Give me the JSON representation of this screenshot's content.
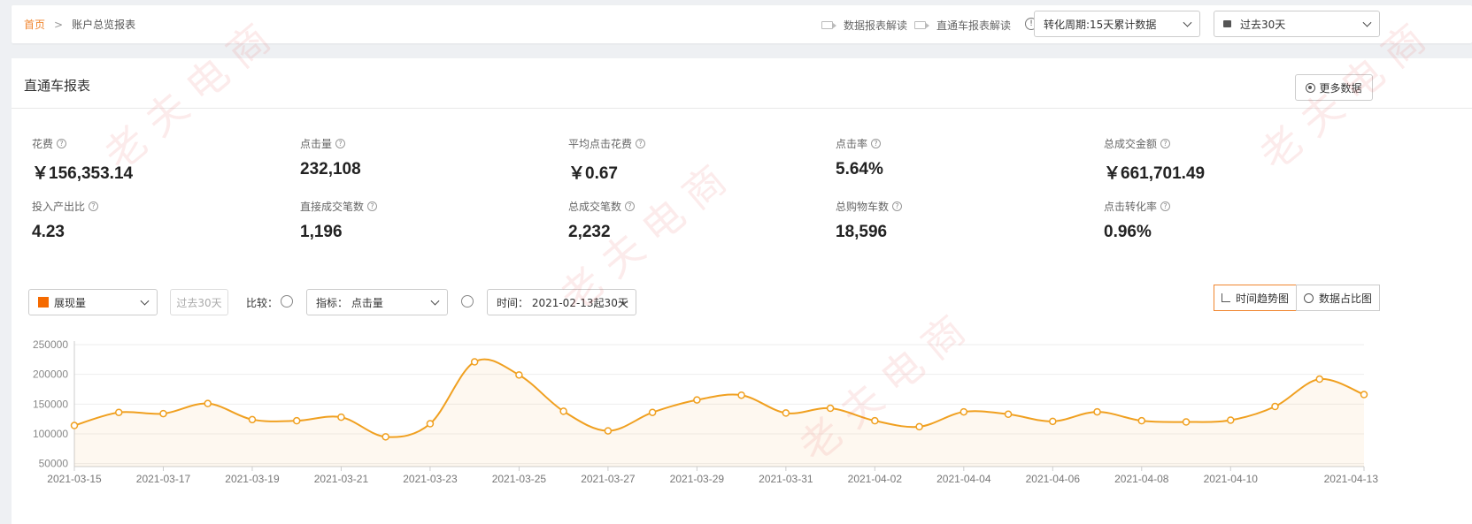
{
  "breadcrumb": {
    "home": "首页",
    "separator": ">",
    "current": "账户总览报表"
  },
  "topbar": {
    "link1": "数据报表解读",
    "link2": "直通车报表解读",
    "period_select": "转化周期:15天累计数据",
    "date_select": "过去30天"
  },
  "panel": {
    "title": "直通车报表",
    "more_button": "更多数据"
  },
  "metrics": [
    {
      "label": "花费",
      "value": "￥156,353.14"
    },
    {
      "label": "点击量",
      "value": "232,108"
    },
    {
      "label": "平均点击花费",
      "value": "￥0.67"
    },
    {
      "label": "点击率",
      "value": "5.64%"
    },
    {
      "label": "总成交金额",
      "value": "￥661,701.49"
    },
    {
      "label": "投入产出比",
      "value": "4.23"
    },
    {
      "label": "直接成交笔数",
      "value": "1,196"
    },
    {
      "label": "总成交笔数",
      "value": "2,232"
    },
    {
      "label": "总购物车数",
      "value": "18,596"
    },
    {
      "label": "点击转化率",
      "value": "0.96%"
    }
  ],
  "controls": {
    "metric_select": "展现量",
    "past_30": "过去30天",
    "compare_label": "比较：",
    "indicator_select": "指标： 点击量",
    "time_select": "时间： 2021-02-13起30天",
    "trend_button": "时间趋势图",
    "share_button": "数据占比图"
  },
  "colors": {
    "accent": "#f0862f",
    "line": "#f0a020",
    "swatch": "#f56a00"
  },
  "watermark": "老夫电商",
  "chart_data": {
    "type": "line",
    "x": [
      "2021-03-15",
      "2021-03-16",
      "2021-03-17",
      "2021-03-18",
      "2021-03-19",
      "2021-03-20",
      "2021-03-21",
      "2021-03-22",
      "2021-03-23",
      "2021-03-24",
      "2021-03-25",
      "2021-03-26",
      "2021-03-27",
      "2021-03-28",
      "2021-03-29",
      "2021-03-30",
      "2021-03-31",
      "2021-04-01",
      "2021-04-02",
      "2021-04-03",
      "2021-04-04",
      "2021-04-05",
      "2021-04-06",
      "2021-04-07",
      "2021-04-08",
      "2021-04-09",
      "2021-04-10",
      "2021-04-11",
      "2021-04-12",
      "2021-04-13"
    ],
    "x_tick_labels": [
      "2021-03-15",
      "2021-03-17",
      "2021-03-19",
      "2021-03-21",
      "2021-03-23",
      "2021-03-25",
      "2021-03-27",
      "2021-03-29",
      "2021-03-31",
      "2021-04-02",
      "2021-04-04",
      "2021-04-06",
      "2021-04-08",
      "2021-04-10",
      "2021-04-13"
    ],
    "values": [
      114000,
      136000,
      134000,
      151000,
      124000,
      122000,
      128000,
      95000,
      117000,
      221000,
      199000,
      138000,
      105000,
      136000,
      157000,
      165000,
      135000,
      143000,
      122000,
      112000,
      137000,
      133000,
      121000,
      137000,
      122000,
      120000,
      123000,
      146000,
      192000,
      166000
    ],
    "y_ticks": [
      50000,
      100000,
      150000,
      200000,
      250000
    ],
    "ylim": [
      45000,
      250000
    ],
    "grid": true
  }
}
